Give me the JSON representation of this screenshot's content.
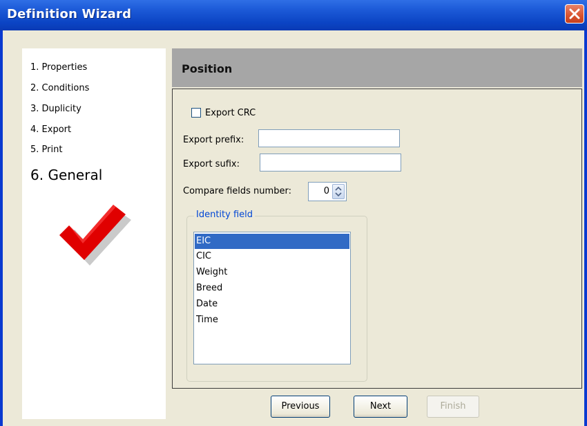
{
  "window": {
    "title": "Definition Wizard"
  },
  "steps": [
    {
      "label": "1. Properties",
      "active": false
    },
    {
      "label": "2. Conditions",
      "active": false
    },
    {
      "label": "3. Duplicity",
      "active": false
    },
    {
      "label": "4. Export",
      "active": false
    },
    {
      "label": "5. Print",
      "active": false
    },
    {
      "label": "6. General",
      "active": true
    }
  ],
  "section": {
    "title": "Position"
  },
  "form": {
    "export_crc_label": "Export CRC",
    "export_crc_checked": false,
    "export_prefix_label": "Export prefix:",
    "export_prefix_value": "",
    "export_sufix_label": "Export sufix:",
    "export_sufix_value": "",
    "compare_fields_label": "Compare fields number:",
    "compare_fields_value": "0"
  },
  "identity_field": {
    "legend": "Identity field",
    "items": [
      "EIC",
      "CIC",
      "Weight",
      "Breed",
      "Date",
      "Time"
    ],
    "selected": "EIC"
  },
  "buttons": {
    "previous": "Previous",
    "next": "Next",
    "finish": "Finish"
  },
  "colors": {
    "title_bar": "#0a3ad0",
    "header_bg": "#a6a6a6",
    "selection": "#316ac5",
    "legend_text": "#0046d5",
    "checkmark": "#e00000"
  }
}
